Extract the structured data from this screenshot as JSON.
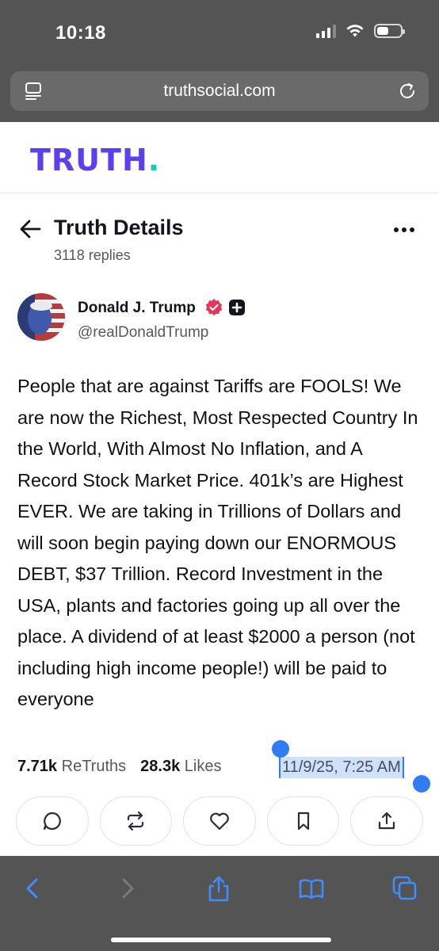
{
  "status_bar": {
    "time": "10:18"
  },
  "browser": {
    "url": "truthsocial.com"
  },
  "site": {
    "brand": "TRUTH",
    "brand_dot": "."
  },
  "header": {
    "title": "Truth Details",
    "replies": "3118 replies"
  },
  "post": {
    "author_name": "Donald J. Trump",
    "handle": "@realDonaldTrump",
    "body": "People that are against Tariffs are FOOLS! We are now the Richest, Most Respected Country In the World, With Almost No Inflation, and A Record Stock Market Price. 401k’s are Highest EVER. We are taking in Trillions of Dollars and will soon begin paying down our ENORMOUS DEBT, $37 Trillion. Record Investment in the USA, plants and factories going up all over the place. A dividend of at least $2000 a person (not including high income people!) will be paid to everyone",
    "retruths_count": "7.71k",
    "retruths_label": "ReTruths",
    "likes_count": "28.3k",
    "likes_label": "Likes",
    "timestamp": "11/9/25, 7:25 AM"
  },
  "actions": [
    {
      "icon": "reply-icon"
    },
    {
      "icon": "retruth-icon"
    },
    {
      "icon": "like-icon"
    },
    {
      "icon": "bookmark-icon"
    },
    {
      "icon": "share-icon"
    }
  ],
  "colors": {
    "brand": "#5b3ff0",
    "brand_dot": "#17c9b6",
    "verified": "#e8355b",
    "selection": "#2f7cf6",
    "toolbar_icon": "#3f8cff"
  },
  "battery_level": 0.5
}
